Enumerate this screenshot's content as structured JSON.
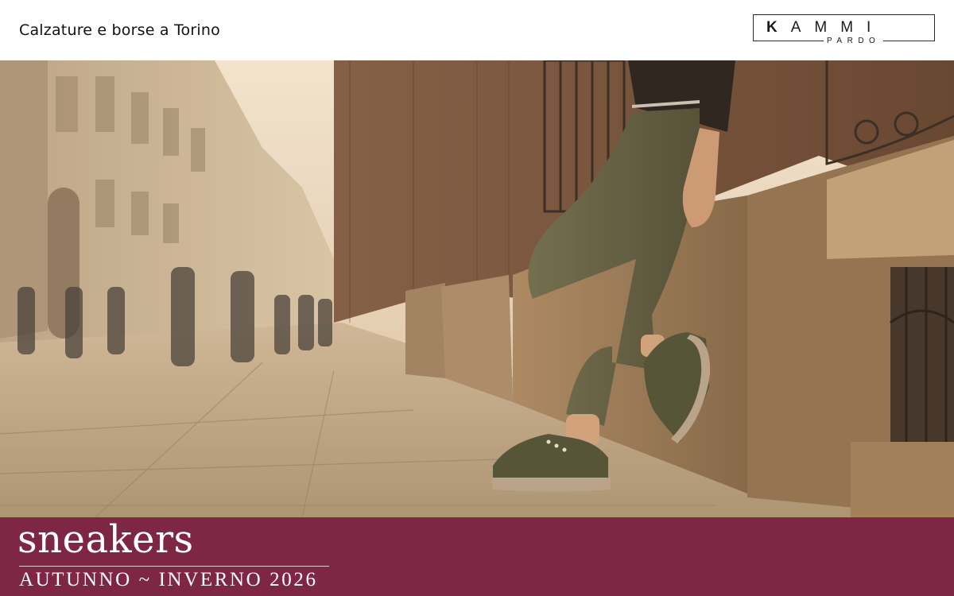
{
  "header": {
    "tagline": "Calzature e borse a Torino",
    "logo": {
      "main": "KAMMI",
      "sub": "PARDO"
    }
  },
  "hero": {
    "image": "street-photo",
    "description_icon": "sneaker-photo"
  },
  "banner": {
    "title": "sneakers",
    "subtitle": "AUTUNNO ~ INVERNO 2026",
    "color": "#7d2745"
  }
}
